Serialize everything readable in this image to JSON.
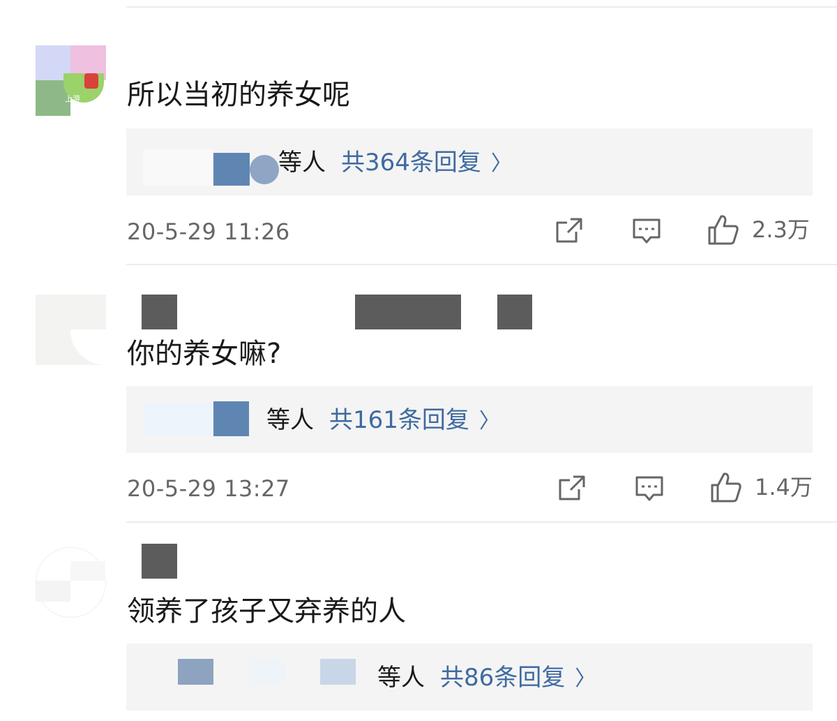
{
  "comments": [
    {
      "text": "所以当初的养女呢",
      "reply_who": "等人",
      "reply_count": "共364条回复",
      "time": "20-5-29 11:26",
      "likes": "2.3万",
      "avatar_badge": "上游"
    },
    {
      "text": "你的养女嘛?",
      "reply_who": "等人",
      "reply_count": "共161条回复",
      "time": "20-5-29 13:27",
      "likes": "1.4万"
    },
    {
      "text": "领养了孩子又弃养的人",
      "reply_who": "等人",
      "reply_count": "共86条回复"
    }
  ],
  "icons": {
    "share": "share-icon",
    "comment": "comment-icon",
    "like": "thumbs-up-icon",
    "more": "chevron-right-icon"
  },
  "colors": {
    "link": "#3f6aa0",
    "reply_bg": "#f4f4f4",
    "meta": "#666666"
  }
}
